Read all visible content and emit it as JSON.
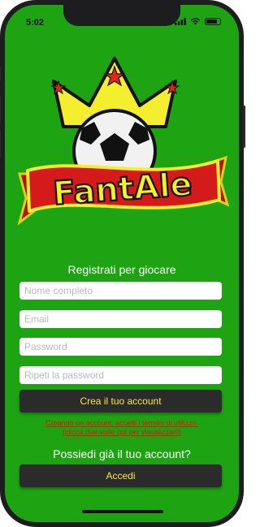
{
  "status_bar": {
    "time": "5:02"
  },
  "logo": {
    "brand_text": "FantAle"
  },
  "register": {
    "title": "Registrati per giocare",
    "fields": {
      "full_name": {
        "placeholder": "Nome completo",
        "value": ""
      },
      "email": {
        "placeholder": "Email",
        "value": ""
      },
      "password": {
        "placeholder": "Password",
        "value": ""
      },
      "repeat_password": {
        "placeholder": "Ripeti la password",
        "value": ""
      }
    },
    "create_button": "Crea il tuo account",
    "terms_line1": "Creando un account, accetti i termini di utilizzo.",
    "terms_line2": "(clicca due volte qui per visualizzarli)"
  },
  "login": {
    "prompt": "Possiedi già il tuo account?",
    "button": "Accedi"
  },
  "colors": {
    "background": "#1ea312",
    "button": "#2b2b2c",
    "button_text": "#f2e93a",
    "terms_link": "#e8130a",
    "banner": "#d41a1a",
    "crown": "#f4ef2e"
  }
}
